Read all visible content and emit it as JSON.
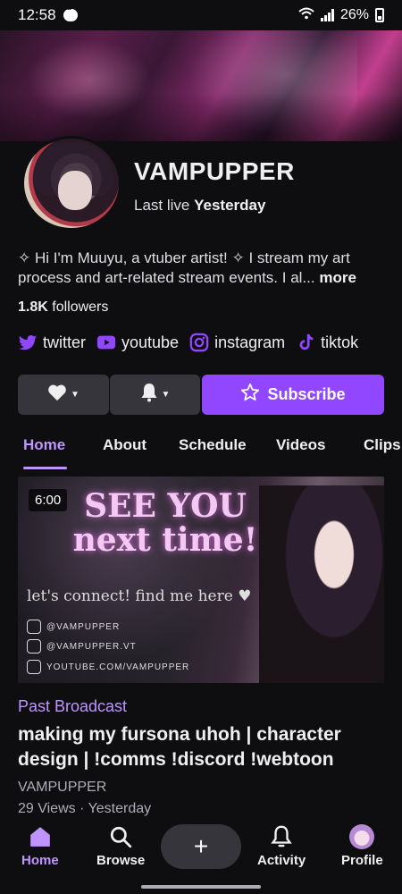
{
  "status_bar": {
    "time": "12:58",
    "battery": "26%"
  },
  "channel": {
    "name": "VAMPUPPER",
    "last_live_label": "Last live",
    "last_live_value": "Yesterday",
    "bio": "✧ Hi I'm Muuyu, a vtuber artist! ✧ I stream my art process and art-related stream events. I al...",
    "bio_more": "more",
    "followers_count": "1.8K",
    "followers_label": "followers"
  },
  "socials": [
    {
      "label": "twitter",
      "icon": "twitter-icon"
    },
    {
      "label": "youtube",
      "icon": "youtube-icon"
    },
    {
      "label": "instagram",
      "icon": "instagram-icon"
    },
    {
      "label": "tiktok",
      "icon": "tiktok-icon"
    }
  ],
  "actions": {
    "subscribe_label": "Subscribe"
  },
  "tabs": [
    "Home",
    "About",
    "Schedule",
    "Videos",
    "Clips"
  ],
  "video": {
    "duration": "6:00",
    "thumbnail_title": "SEE YOU next time!",
    "thumbnail_subtitle": "let's connect! find me here ♥",
    "thumbnail_links": [
      "@VAMPUPPER",
      "@VAMPUPPER.VT",
      "YOUTUBE.COM/VAMPUPPER"
    ],
    "kind": "Past Broadcast",
    "title": "making my fursona uhoh | character design | !comms !discord !webtoon",
    "channel": "VAMPUPPER",
    "meta": "29 Views · Yesterday"
  },
  "bottom_nav": {
    "home": "Home",
    "browse": "Browse",
    "add": "+",
    "activity": "Activity",
    "profile": "Profile"
  },
  "colors": {
    "accent": "#9147ff",
    "accent_text": "#bf94ff",
    "background": "#0e0e10",
    "button_gray": "#35353b"
  }
}
